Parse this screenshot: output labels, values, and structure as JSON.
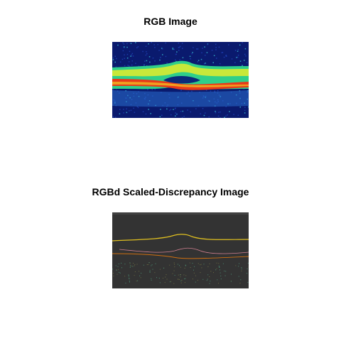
{
  "figure": {
    "panels": [
      {
        "title": "RGB Image",
        "colors": {
          "background": "#0a1a6e",
          "noise": "#1b3aa8",
          "outer_band": "#2fcf8a",
          "inner_band": "#c8e83a",
          "hot_band": "#e83a1a",
          "cyst": "#0b2a7a",
          "choroid": "#2a6fd0"
        }
      },
      {
        "title": "RGBd Scaled-Discrepancy Image",
        "colors": {
          "background": "#333333",
          "contour_yellow": "#e0c020",
          "contour_orange": "#d07010",
          "contour_pink": "#d08090",
          "speckle": "#4a8a70"
        }
      }
    ]
  }
}
